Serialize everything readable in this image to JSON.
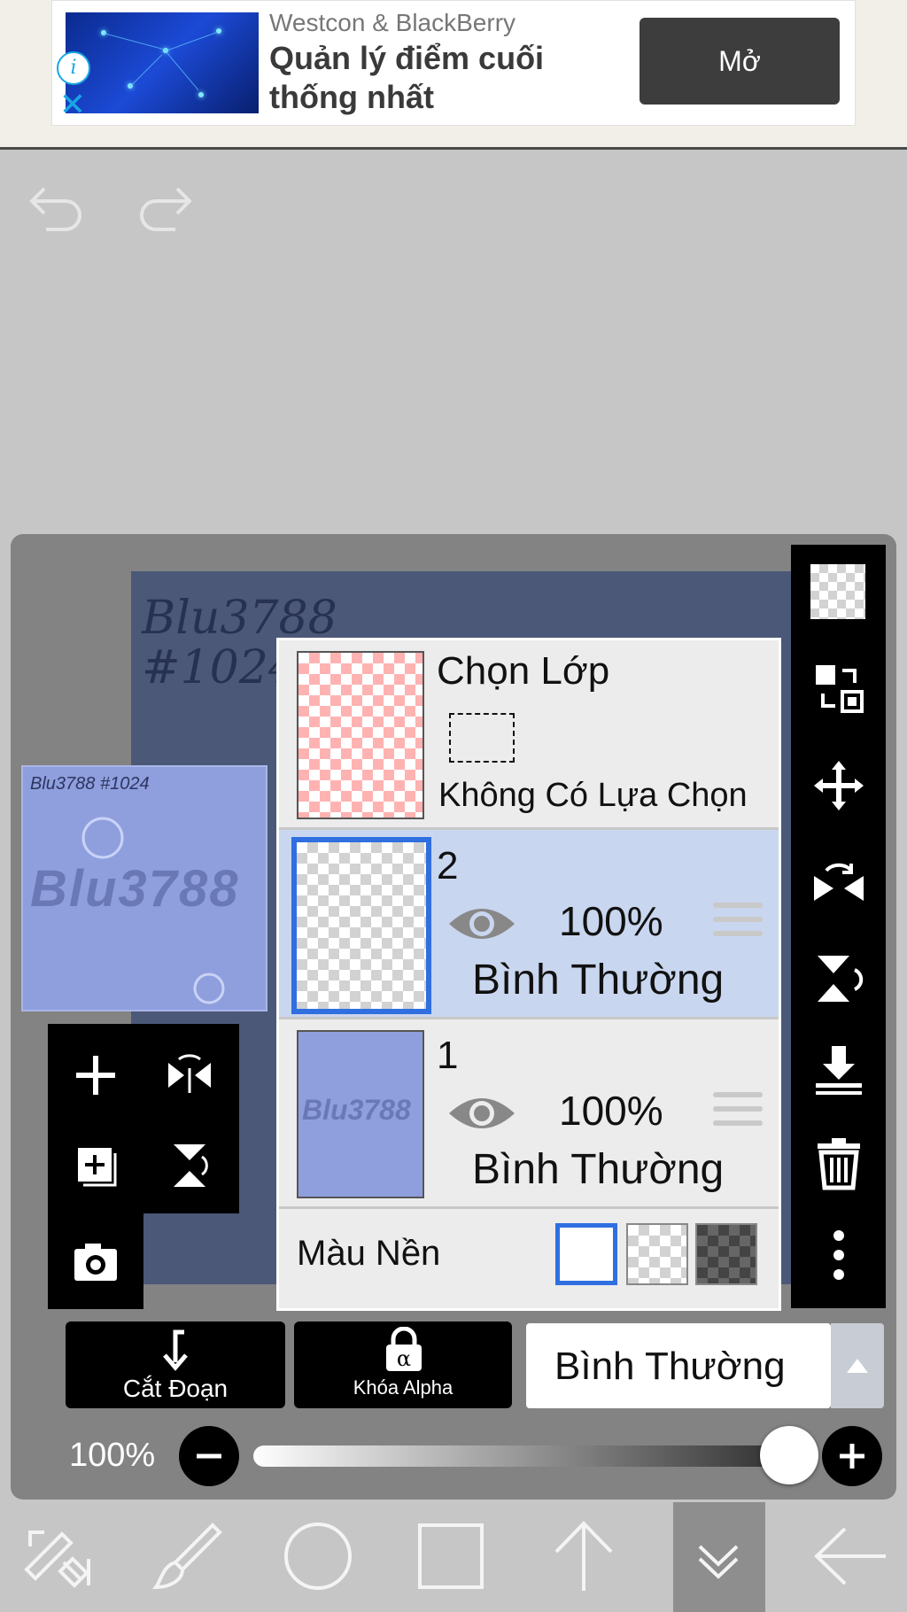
{
  "ad": {
    "advertiser": "Westcon & BlackBerry",
    "headline": "Quản lý điểm cuối thống nhất",
    "cta_label": "Mở",
    "info_icon": "info-icon",
    "close_icon": "close-icon"
  },
  "toolbar": {
    "undo_icon": "undo-icon",
    "redo_icon": "redo-icon"
  },
  "canvas": {
    "scribble_line1": "Blu3788",
    "scribble_line2": "#1024"
  },
  "preview": {
    "big_text": "Blu3788",
    "small_text": "Blu3788 #1024"
  },
  "selection_layer": {
    "title": "Chọn Lớp",
    "subtitle": "Không Có Lựa Chọn"
  },
  "layers": [
    {
      "name": "2",
      "opacity": "100%",
      "blend_mode": "Bình Thường",
      "selected": true
    },
    {
      "name": "1",
      "opacity": "100%",
      "blend_mode": "Bình Thường",
      "selected": false
    }
  ],
  "background": {
    "label": "Màu Nền",
    "options": [
      "white",
      "transparent",
      "dark-checker"
    ],
    "selected": "white"
  },
  "bottom_controls": {
    "clipping_label": "Cắt Đoạn",
    "alpha_lock_label": "Khóa Alpha",
    "blend_mode_value": "Bình Thường"
  },
  "opacity": {
    "label": "100%",
    "value": 1.0
  },
  "colors": {
    "accent_blue": "#2f6fe0",
    "selected_row": "#c9d6ef",
    "panel_bg": "#838383"
  }
}
